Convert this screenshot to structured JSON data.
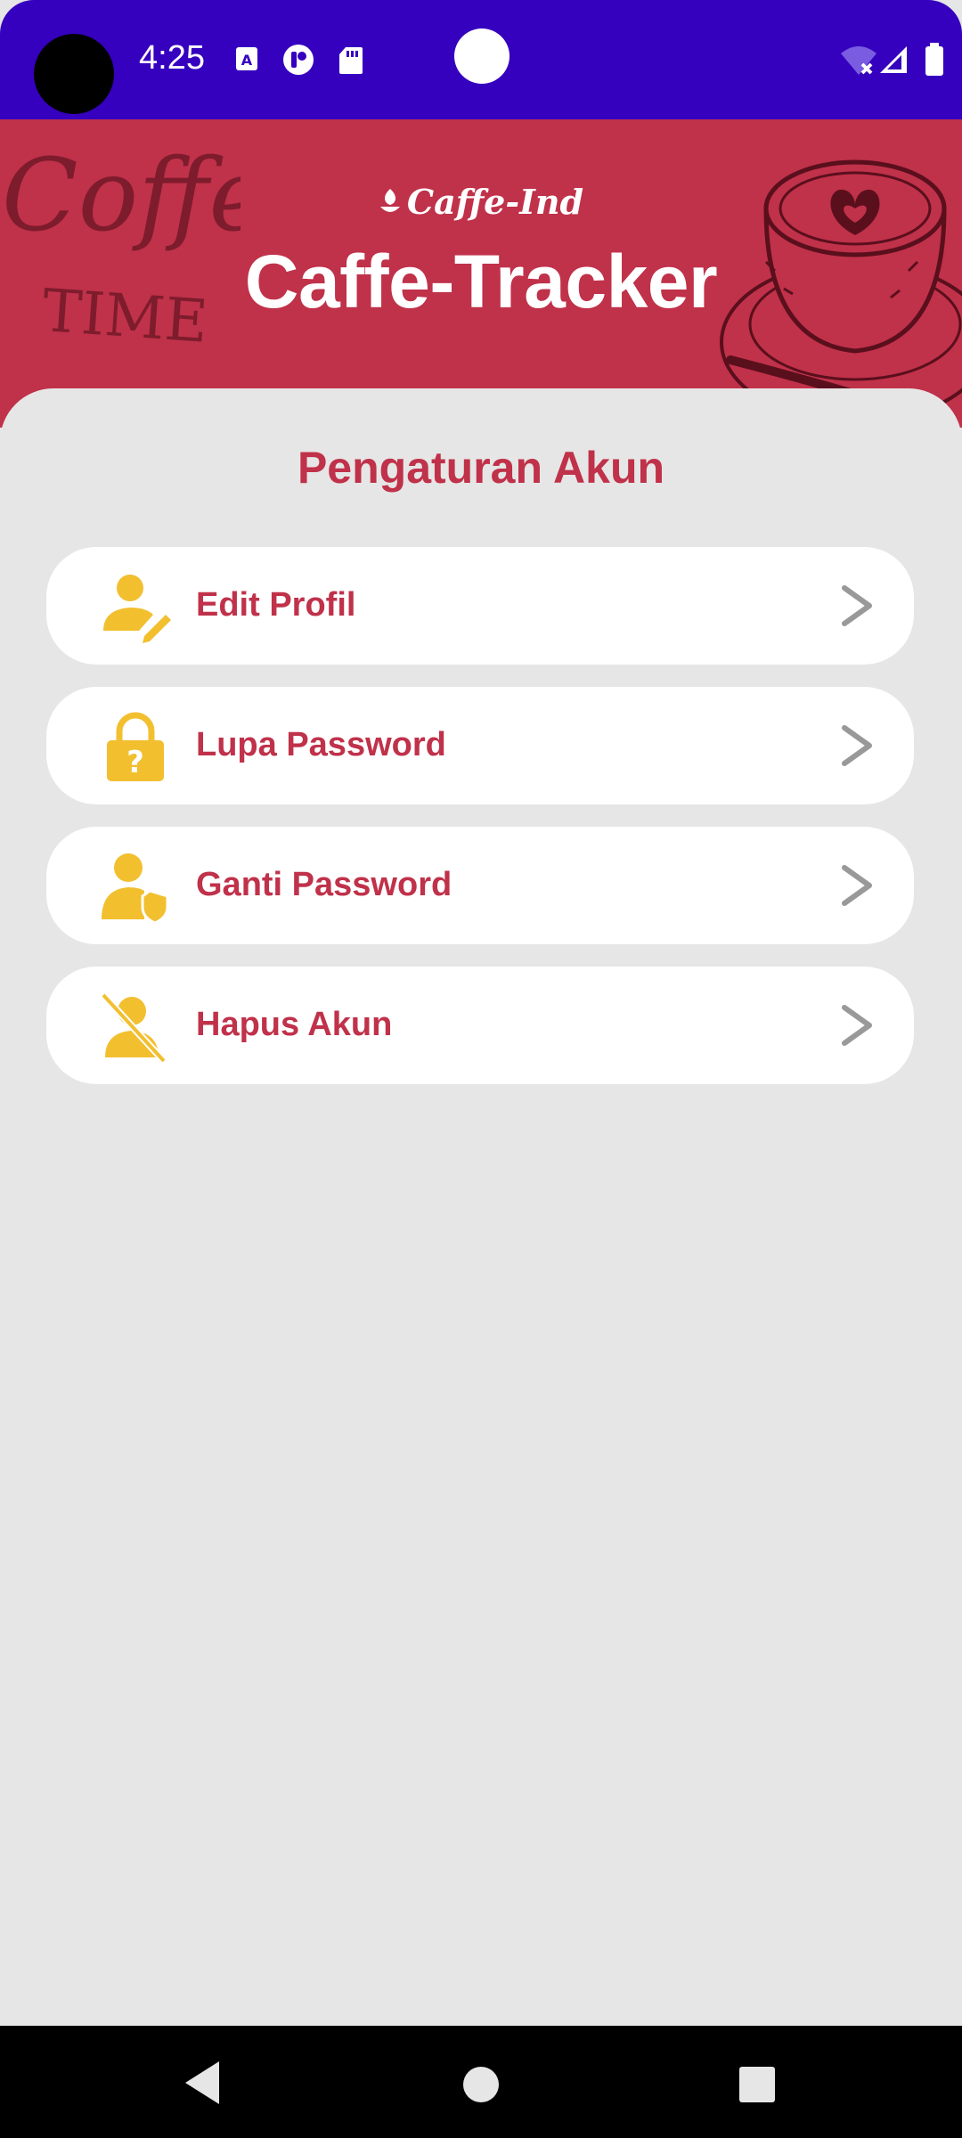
{
  "status_bar": {
    "time": "4:25",
    "icons": [
      "a-badge-icon",
      "cast-icon",
      "sd-card-icon",
      "wifi-off-icon",
      "signal-icon",
      "battery-icon"
    ]
  },
  "header": {
    "brand": "Caffe-Ind",
    "title": "Caffe-Tracker",
    "art_text_top": "Coffee",
    "art_text_bottom": "TIME",
    "background_color": "#c0314a"
  },
  "settings": {
    "title": "Pengaturan Akun",
    "items": [
      {
        "label": "Edit Profil",
        "icon": "person-edit-icon"
      },
      {
        "label": "Lupa Password",
        "icon": "lock-question-icon"
      },
      {
        "label": "Ganti Password",
        "icon": "person-shield-icon"
      },
      {
        "label": "Hapus Akun",
        "icon": "person-off-icon"
      }
    ]
  },
  "colors": {
    "accent": "#c0314a",
    "icon": "#f2bf2f",
    "status_bar": "#3600bf"
  }
}
